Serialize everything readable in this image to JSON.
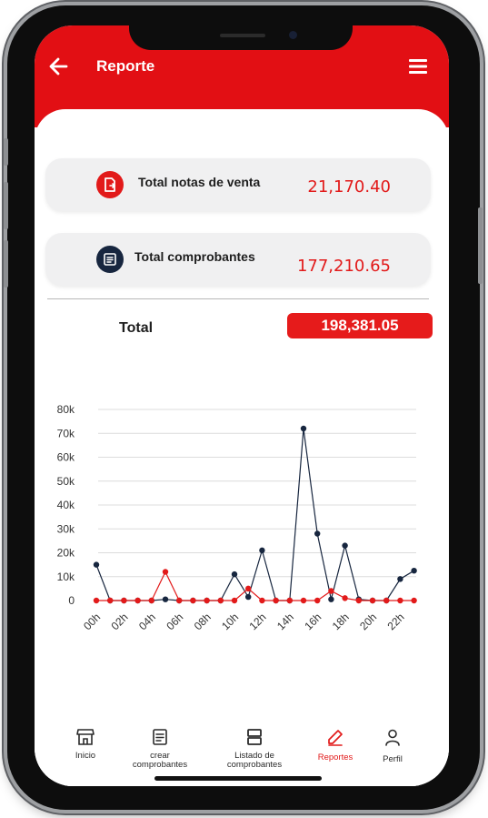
{
  "header": {
    "title": "Reporte",
    "back_icon": "arrow-left-icon",
    "menu_icon": "hamburger-menu-icon"
  },
  "summary": {
    "sales_notes": {
      "label": "Total notas de venta",
      "value": "21,170.40",
      "icon": "document-icon",
      "icon_color": "#e21a1a"
    },
    "receipts": {
      "label": "Total comprobantes",
      "value": "177,210.65",
      "icon": "receipt-icon",
      "icon_color": "#17263f"
    }
  },
  "total": {
    "label": "Total",
    "value": "198,381.05"
  },
  "colors": {
    "brand_red": "#e20f14",
    "dark_navy": "#17263f",
    "grid": "#dcdcdc"
  },
  "chart_data": {
    "type": "line",
    "y_ticks": [
      "0",
      "10k",
      "20k",
      "30k",
      "40k",
      "50k",
      "60k",
      "70k",
      "80k"
    ],
    "ylim": [
      0,
      80000
    ],
    "x_tick_labels": [
      "00h",
      "02h",
      "04h",
      "06h",
      "08h",
      "10h",
      "12h",
      "14h",
      "16h",
      "18h",
      "20h",
      "22h"
    ],
    "grid": true,
    "series": [
      {
        "color": "#17263f",
        "points": [
          [
            0,
            15000
          ],
          [
            1,
            0
          ],
          [
            2,
            0
          ],
          [
            3,
            0
          ],
          [
            4,
            0
          ],
          [
            5,
            500
          ],
          [
            6,
            0
          ],
          [
            7,
            0
          ],
          [
            8,
            0
          ],
          [
            9,
            0
          ],
          [
            10,
            11000
          ],
          [
            11,
            1500
          ],
          [
            12,
            21000
          ],
          [
            13,
            0
          ],
          [
            14,
            0
          ],
          [
            15,
            72000
          ],
          [
            16,
            28000
          ],
          [
            17,
            500
          ],
          [
            18,
            23000
          ],
          [
            19,
            500
          ],
          [
            20,
            0
          ],
          [
            21,
            0
          ],
          [
            22,
            9000
          ],
          [
            23,
            12500
          ]
        ]
      },
      {
        "color": "#e21a1a",
        "points": [
          [
            0,
            0
          ],
          [
            1,
            0
          ],
          [
            2,
            0
          ],
          [
            3,
            0
          ],
          [
            4,
            0
          ],
          [
            5,
            12000
          ],
          [
            6,
            0
          ],
          [
            7,
            0
          ],
          [
            8,
            0
          ],
          [
            9,
            0
          ],
          [
            10,
            0
          ],
          [
            11,
            5000
          ],
          [
            12,
            0
          ],
          [
            13,
            0
          ],
          [
            14,
            0
          ],
          [
            15,
            0
          ],
          [
            16,
            0
          ],
          [
            17,
            4000
          ],
          [
            18,
            1000
          ],
          [
            19,
            0
          ],
          [
            20,
            0
          ],
          [
            21,
            0
          ],
          [
            22,
            0
          ],
          [
            23,
            0
          ]
        ]
      }
    ]
  },
  "nav": [
    {
      "label": "Inicio",
      "icon": "store-icon",
      "active": false
    },
    {
      "label": "crear comprobantes",
      "icon": "receipt-icon",
      "active": false
    },
    {
      "label": "Listado de comprobantes",
      "icon": "list-icon",
      "active": false
    },
    {
      "label": "Reportes",
      "icon": "pencil-icon",
      "active": true
    },
    {
      "label": "Perfil",
      "icon": "user-icon",
      "active": false
    }
  ]
}
